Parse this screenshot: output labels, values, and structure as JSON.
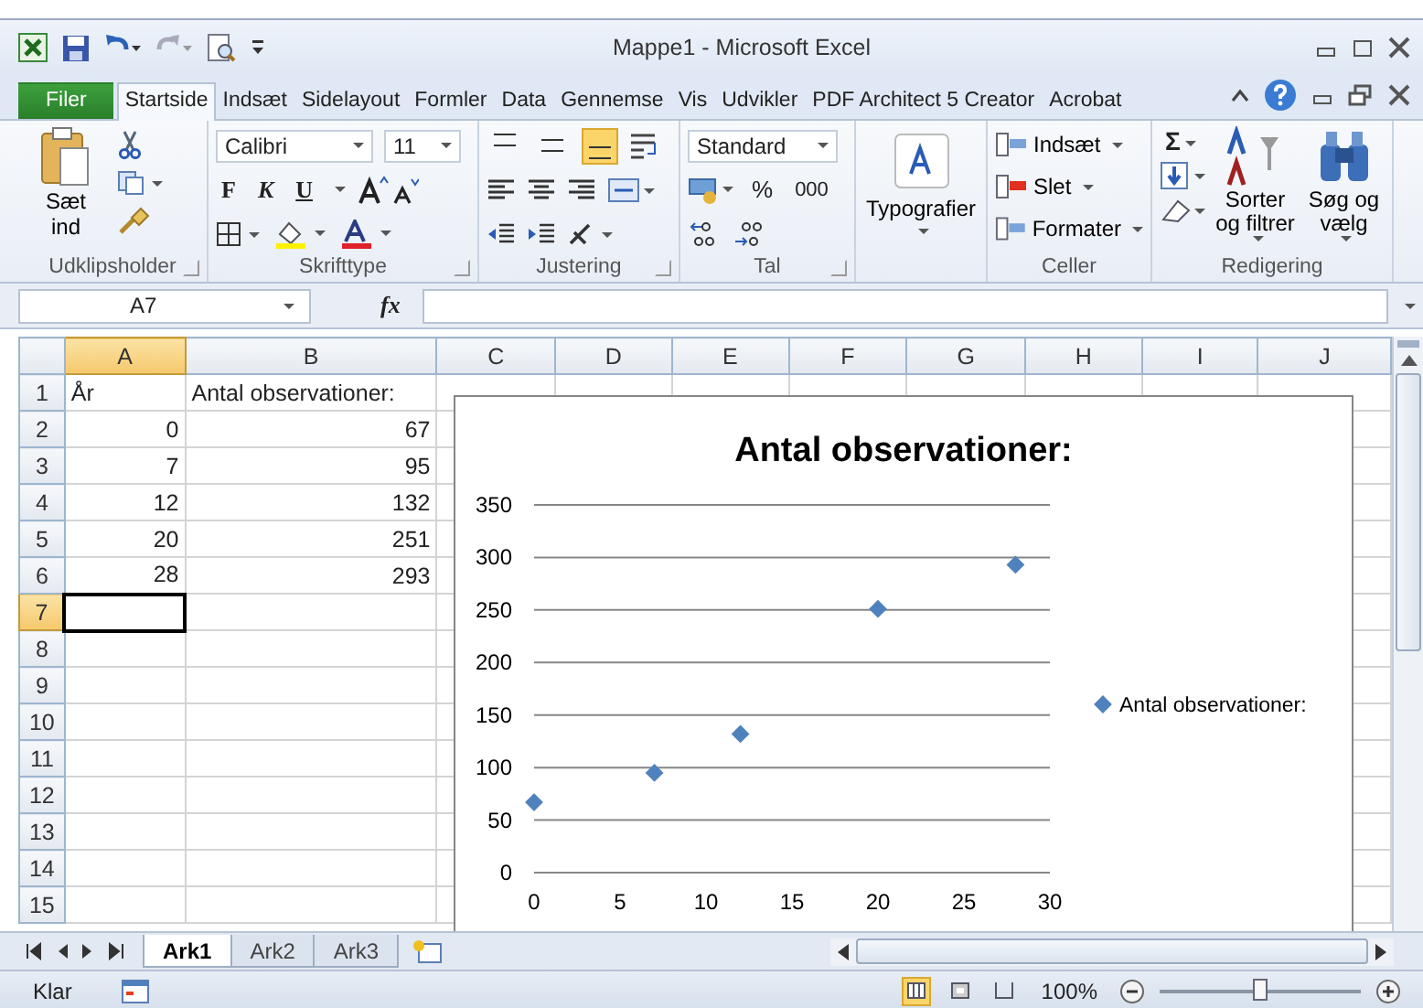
{
  "window": {
    "title": "Mappe1 - Microsoft Excel"
  },
  "ribbon_tabs": [
    {
      "label": "Filer",
      "kind": "file",
      "selected": false
    },
    {
      "label": "Startside",
      "kind": "tab",
      "selected": true
    },
    {
      "label": "Indsæt",
      "kind": "tab",
      "selected": false
    },
    {
      "label": "Sidelayout",
      "kind": "tab",
      "selected": false
    },
    {
      "label": "Formler",
      "kind": "tab",
      "selected": false
    },
    {
      "label": "Data",
      "kind": "tab",
      "selected": false
    },
    {
      "label": "Gennemse",
      "kind": "tab",
      "selected": false
    },
    {
      "label": "Vis",
      "kind": "tab",
      "selected": false
    },
    {
      "label": "Udvikler",
      "kind": "tab",
      "selected": false
    },
    {
      "label": "PDF Architect 5 Creator",
      "kind": "tab",
      "selected": false
    },
    {
      "label": "Acrobat",
      "kind": "tab",
      "selected": false
    }
  ],
  "ribbon": {
    "clipboard": {
      "paste_label": "Sæt ind",
      "group_label": "Udklipsholder"
    },
    "font": {
      "font_name": "Calibri",
      "font_size": "11",
      "bold": "F",
      "italic": "K",
      "underline": "U",
      "group_label": "Skrifttype"
    },
    "alignment": {
      "vertical_align": [
        {
          "selected": false
        },
        {
          "selected": false
        },
        {
          "selected": true
        }
      ],
      "group_label": "Justering"
    },
    "number": {
      "format": "Standard",
      "percent": "%",
      "thousands": "000",
      "group_label": "Tal"
    },
    "styles": {
      "label": "Typografier"
    },
    "cells": {
      "buttons": [
        "Indsæt",
        "Slet",
        "Formater"
      ],
      "group_label": "Celler"
    },
    "editing": {
      "sigma": "Σ",
      "sort": "Sorter og filtrer",
      "find": "Søg og vælg",
      "group_label": "Redigering"
    }
  },
  "formula_bar": {
    "name_box": "A7",
    "fx": "fx"
  },
  "grid": {
    "columns": [
      {
        "label": "A",
        "selected": true
      },
      {
        "label": "B",
        "selected": false
      },
      {
        "label": "C",
        "selected": false
      },
      {
        "label": "D",
        "selected": false
      },
      {
        "label": "E",
        "selected": false
      },
      {
        "label": "F",
        "selected": false
      },
      {
        "label": "G",
        "selected": false
      },
      {
        "label": "H",
        "selected": false
      },
      {
        "label": "I",
        "selected": false
      },
      {
        "label": "J",
        "selected": false
      }
    ],
    "rows": [
      {
        "label": "1",
        "selected": false,
        "cells": [
          {
            "value": "År",
            "kind": "text"
          },
          {
            "value": "Antal observationer:",
            "kind": "text"
          }
        ]
      },
      {
        "label": "2",
        "selected": false,
        "cells": [
          {
            "value": "0",
            "kind": "number"
          },
          {
            "value": "67",
            "kind": "number"
          }
        ]
      },
      {
        "label": "3",
        "selected": false,
        "cells": [
          {
            "value": "7",
            "kind": "number"
          },
          {
            "value": "95",
            "kind": "number"
          }
        ]
      },
      {
        "label": "4",
        "selected": false,
        "cells": [
          {
            "value": "12",
            "kind": "number"
          },
          {
            "value": "132",
            "kind": "number"
          }
        ]
      },
      {
        "label": "5",
        "selected": false,
        "cells": [
          {
            "value": "20",
            "kind": "number"
          },
          {
            "value": "251",
            "kind": "number"
          }
        ]
      },
      {
        "label": "6",
        "selected": false,
        "cells": [
          {
            "value": "28",
            "kind": "number"
          },
          {
            "value": "293",
            "kind": "number"
          }
        ]
      },
      {
        "label": "7",
        "selected": true,
        "cells": []
      },
      {
        "label": "8",
        "selected": false,
        "cells": []
      },
      {
        "label": "9",
        "selected": false,
        "cells": []
      },
      {
        "label": "10",
        "selected": false,
        "cells": []
      },
      {
        "label": "11",
        "selected": false,
        "cells": []
      },
      {
        "label": "12",
        "selected": false,
        "cells": []
      },
      {
        "label": "13",
        "selected": false,
        "cells": []
      },
      {
        "label": "14",
        "selected": false,
        "cells": []
      },
      {
        "label": "15",
        "selected": false,
        "cells": []
      }
    ]
  },
  "chart": {
    "chart_data": {
      "type": "scatter",
      "title": "Antal observationer:",
      "x": [
        0,
        7,
        12,
        20,
        28
      ],
      "series": [
        {
          "name": "Antal observationer:",
          "color": "#4f81bd",
          "values": [
            67,
            95,
            132,
            251,
            293
          ]
        }
      ],
      "grid": true,
      "xlim": [
        0,
        30
      ],
      "ylim": [
        0,
        350
      ],
      "xticks": [
        0,
        5,
        10,
        15,
        20,
        25,
        30
      ],
      "yticks": [
        0,
        50,
        100,
        150,
        200,
        250,
        300,
        350
      ]
    }
  },
  "sheet_tabs": [
    {
      "label": "Ark1",
      "selected": true
    },
    {
      "label": "Ark2",
      "selected": false
    },
    {
      "label": "Ark3",
      "selected": false
    }
  ],
  "status_bar": {
    "status": "Klar",
    "views": [
      {
        "selected": true
      },
      {
        "selected": false
      },
      {
        "selected": false
      }
    ],
    "zoom": "100%",
    "zoom_slider": {
      "level": 0.5
    }
  }
}
